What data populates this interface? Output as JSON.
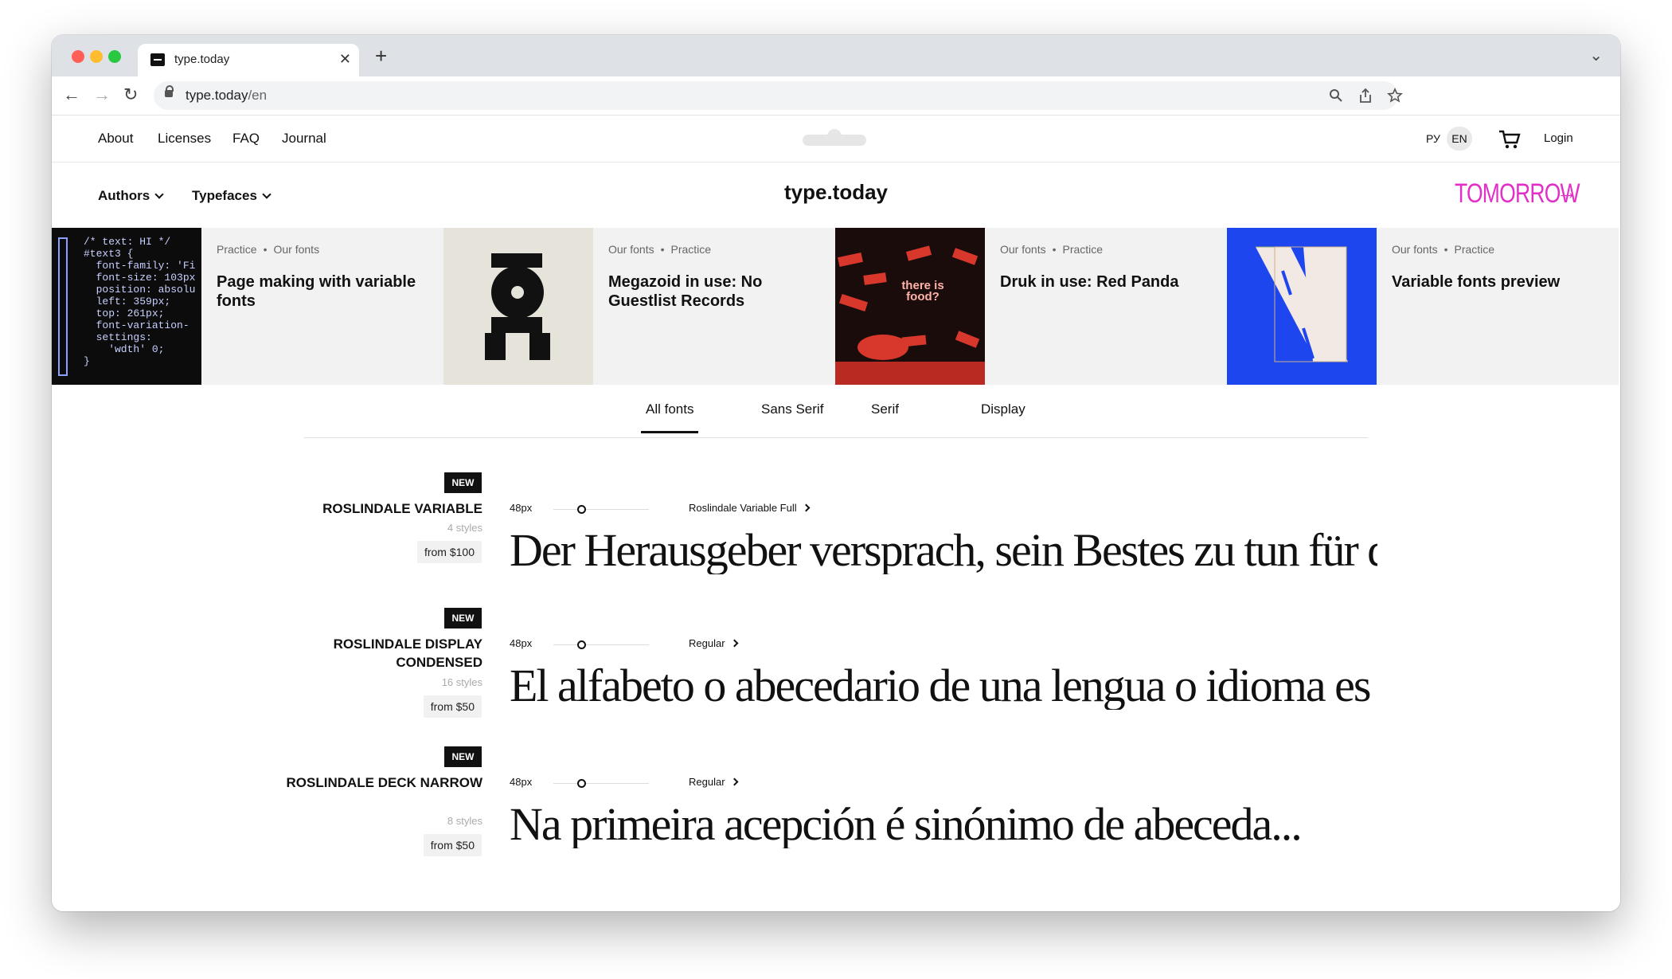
{
  "browser": {
    "tab_title": "type.today",
    "tab_close": "✕",
    "new_tab": "+",
    "url_host": "type.today",
    "url_path": "/en"
  },
  "topnav": {
    "links": [
      "About",
      "Licenses",
      "FAQ",
      "Journal"
    ],
    "lang_ru": "РУ",
    "lang_en": "EN",
    "login": "Login"
  },
  "catnav": {
    "authors": "Authors",
    "typefaces": "Typefaces",
    "site_title": "type.today",
    "tomorrow": "TOMORROW",
    "tomorrow_arrow": "→",
    "accent_color": "#e12fc7"
  },
  "cards": [
    {
      "meta1": "Practice",
      "meta2": "Our fonts",
      "title": "Page making with variable fonts"
    },
    {
      "meta1": "Our fonts",
      "meta2": "Practice",
      "title": "Megazoid in use: No Guestlist Records"
    },
    {
      "meta1": "Our fonts",
      "meta2": "Practice",
      "title": "Druk in use: Red Panda"
    },
    {
      "meta1": "Our fonts",
      "meta2": "Practice",
      "title": "Variable fonts preview"
    }
  ],
  "card_code": "/* text: HI */\n#text3 {\n  font-family: 'Fi\n  font-size: 103px\n  position: absolu\n  left: 359px;\n  top: 261px;\n  font-variation-\n  settings:\n    'wdth' 0;\n}",
  "card_red_text": "there is food?",
  "filter_tabs": [
    "All fonts",
    "Sans Serif",
    "Serif",
    "Display"
  ],
  "fonts": [
    {
      "badge": "NEW",
      "name": "ROSLINDALE VARIABLE",
      "styles": "4 styles",
      "price": "from $100",
      "size": "48px",
      "style": "Roslindale Variable Full",
      "sample": "Der Herausgeber versprach, sein Bestes zu tun für den..."
    },
    {
      "badge": "NEW",
      "name": "ROSLINDALE DISPLAY CONDENSED",
      "styles": "16 styles",
      "price": "from $50",
      "size": "48px",
      "style": "Regular",
      "sample": "El alfabeto o abecedario de una lengua o idioma es el c..."
    },
    {
      "badge": "NEW",
      "name": "ROSLINDALE DECK NARROW",
      "styles": "8 styles",
      "price": "from $50",
      "size": "48px",
      "style": "Regular",
      "sample": "Na primeira acepción é sinónimo de abeceda..."
    }
  ]
}
